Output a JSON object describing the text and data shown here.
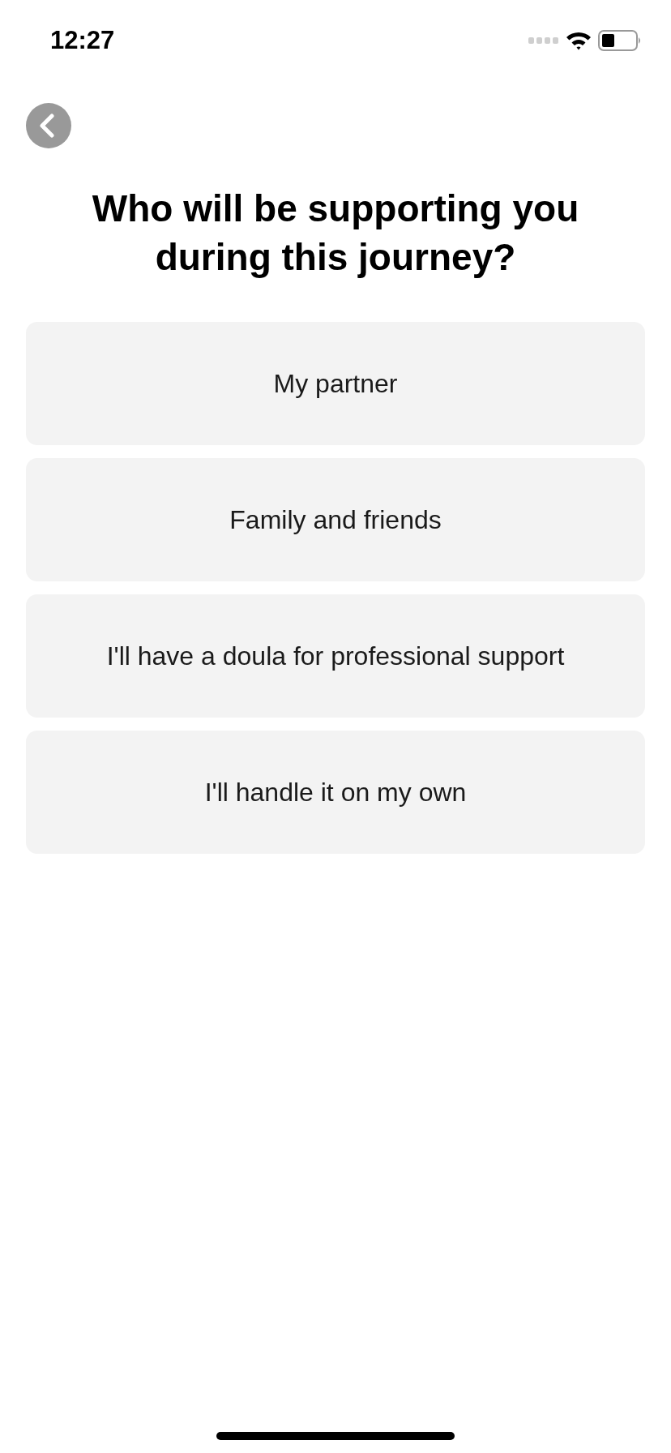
{
  "status_bar": {
    "time": "12:27"
  },
  "title": "Who will be supporting you during this journey?",
  "options": [
    {
      "label": "My partner"
    },
    {
      "label": "Family and friends"
    },
    {
      "label": "I'll have a doula for professional support"
    },
    {
      "label": "I'll handle it on my own"
    }
  ]
}
